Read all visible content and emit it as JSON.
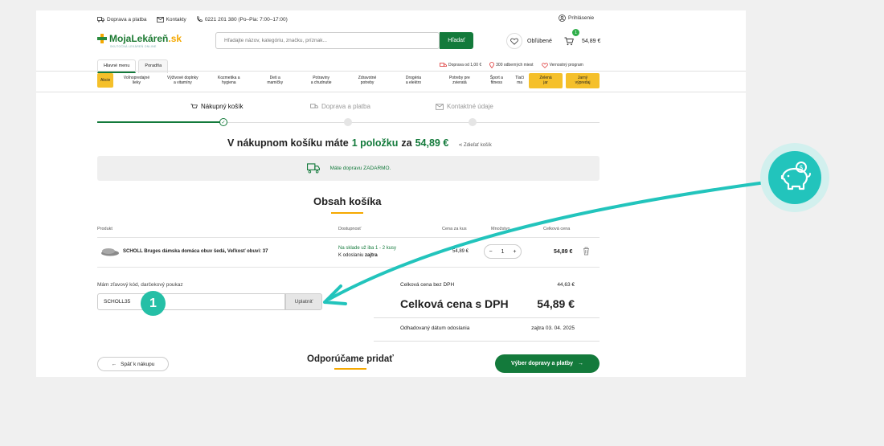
{
  "topbar": {
    "delivery": "Doprava a platba",
    "contacts": "Kontakty",
    "phone": "0221 201 380 (Po–Pia: 7:00–17:00)",
    "login": "Prihlásenie"
  },
  "logo": {
    "name_a": "MojaLekáreň",
    "name_b": ".sk",
    "tagline": "SKUTOČNÁ LEKÁREŇ ONLINE"
  },
  "search": {
    "placeholder": "Hľadajte názov, kategóriu, značku, príznak...",
    "button": "Hľadať"
  },
  "favorites": "Obľúbené",
  "cart": {
    "count": "1",
    "price": "54,89 €"
  },
  "tabs": [
    "Hlavné menu",
    "Poradňa"
  ],
  "promos": [
    "Doprava od 1,00 €",
    "300 odberných miest",
    "Vernostný program"
  ],
  "nav": {
    "akcie": "Akcie",
    "items": [
      "Voľnopredajné\nlieky",
      "Výživové doplnky\na vitamíny",
      "Kozmetika a\nhygiena",
      "Deti a\nmamičky",
      "Potraviny\na chudnutie",
      "Zdravotné\npotreby",
      "Drogéria\na elektro",
      "Potreby pre\nzvieratá",
      "Šport a\nfitness",
      "Tlači\nma"
    ],
    "green": "Zelená\njar",
    "sale": "Jarný\nvýpredaj"
  },
  "steps": [
    "Nákupný košík",
    "Doprava a platba",
    "Kontaktné údaje"
  ],
  "headline": {
    "prefix": "V nákupnom košíku máte",
    "count": "1 položku",
    "mid": "za",
    "amount": "54,89 €",
    "share": "Zdieľať košík"
  },
  "free_shipping": "Máte dopravu ZADARMO.",
  "contents_title": "Obsah košíka",
  "table": {
    "headers": {
      "product": "Produkt",
      "availability": "Dostupnosť",
      "unit": "Cena za kus",
      "qty": "Množstvo",
      "total": "Celková cena"
    },
    "row": {
      "name": "SCHOLL Bruges dámska domáca obuv šedá, Veľkosť obuvi: 37",
      "stock": "Na sklade už iba 1 - 2 kusy",
      "ship_prefix": "K odoslaniu",
      "ship_day": "zajtra",
      "unit": "54,89 €",
      "qty": "1",
      "total": "54,89 €"
    }
  },
  "coupon": {
    "label": "Mám zľavový kód, darčekový poukaz",
    "value": "SCHOLL35",
    "button": "Uplatniť"
  },
  "summary": {
    "net_label": "Celková cena bez DPH",
    "net_value": "44,63 €",
    "gross_label": "Celková cena s DPH",
    "gross_value": "54,89 €",
    "date_label": "Odhadovaný dátum odoslania",
    "date_value": "zajtra 03. 04. 2025"
  },
  "back_button": "Späť k nákupu",
  "recommend_title": "Odporúčame pridať",
  "next_button": "Výber dopravy a platby",
  "callout_number": "1",
  "colors": {
    "brand_green": "#137a3b",
    "accent_yellow": "#f5c02a",
    "callout_teal": "#22c4bc"
  }
}
